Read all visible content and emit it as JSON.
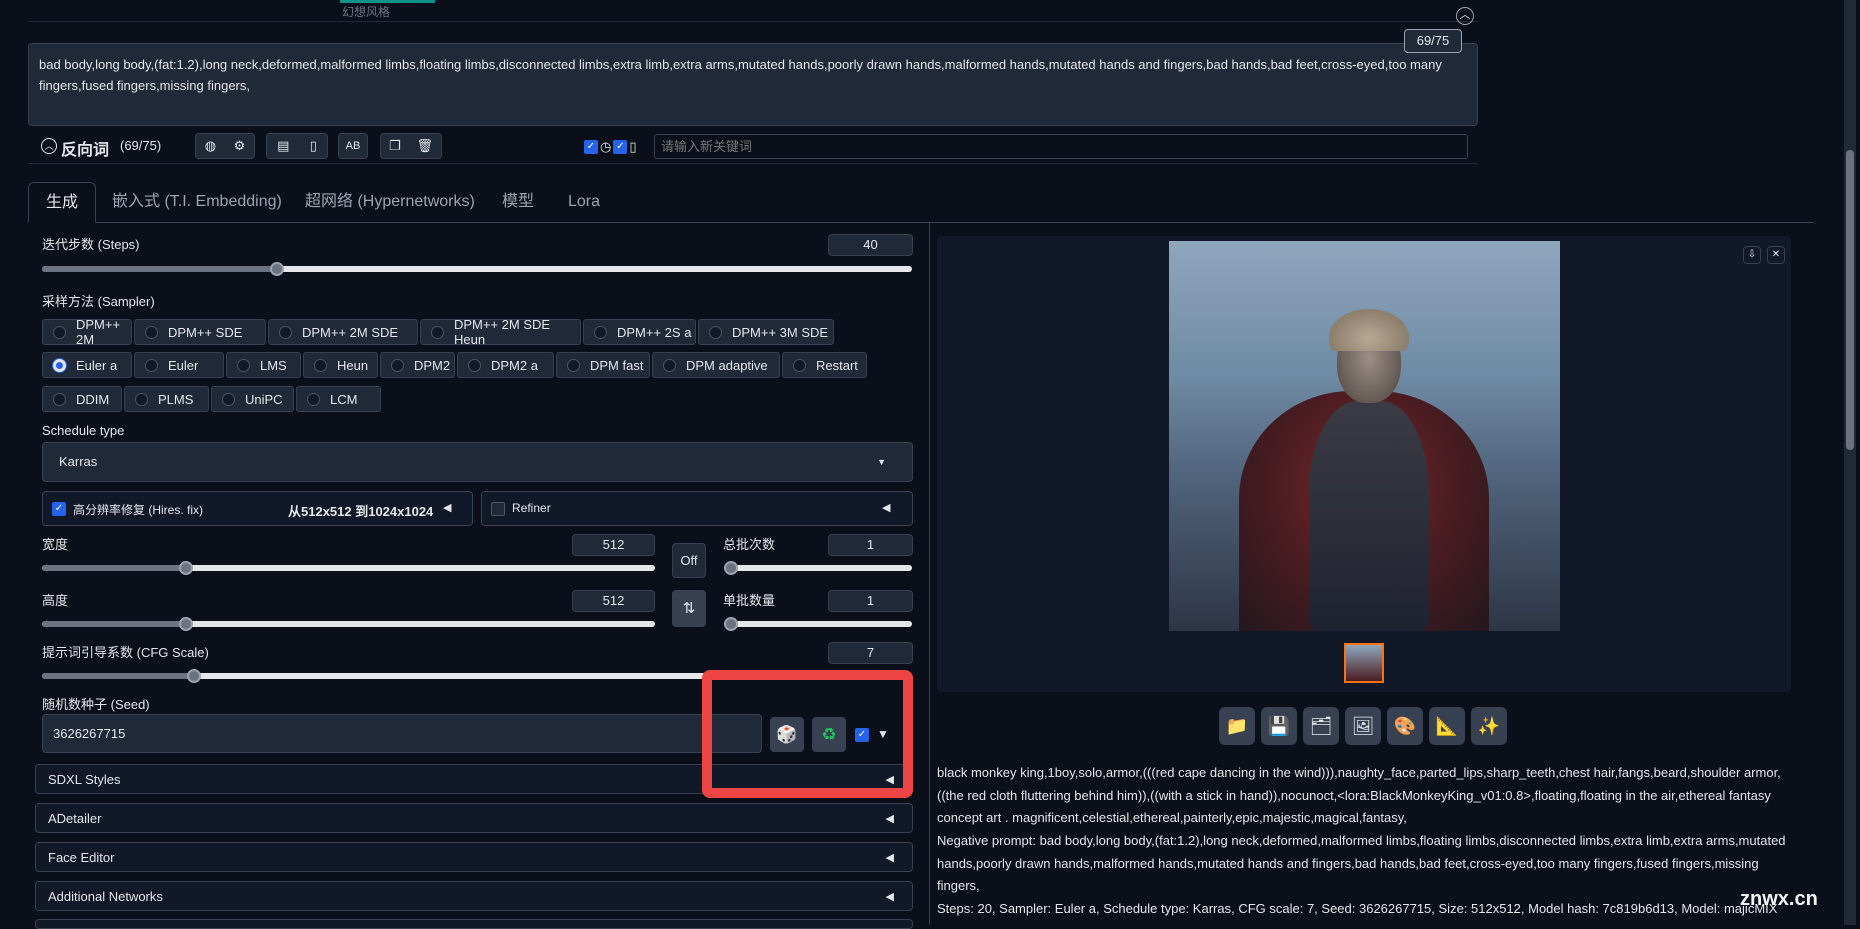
{
  "top": {
    "style_hint": "幻想风格"
  },
  "negative": {
    "text": "bad body,long body,(fat:1.2),long neck,deformed,malformed limbs,floating limbs,disconnected limbs,extra limb,extra arms,mutated hands,poorly drawn hands,malformed hands,mutated hands and fingers,bad hands,bad feet,cross-eyed,too many fingers,fused fingers,missing fingers,",
    "token_count": "69/75",
    "title": "反向词",
    "count": "(69/75)",
    "keyword_placeholder": "请输入新关键词"
  },
  "tabs": [
    "生成",
    "嵌入式 (T.I. Embedding)",
    "超网络 (Hypernetworks)",
    "模型",
    "Lora"
  ],
  "steps": {
    "label": "迭代步数 (Steps)",
    "value": "40",
    "fraction": 0.27
  },
  "sampler": {
    "label": "采样方法 (Sampler)",
    "options": [
      "DPM++ 2M",
      "DPM++ SDE",
      "DPM++ 2M SDE",
      "DPM++ 2M SDE Heun",
      "DPM++ 2S a",
      "DPM++ 3M SDE",
      "Euler a",
      "Euler",
      "LMS",
      "Heun",
      "DPM2",
      "DPM2 a",
      "DPM fast",
      "DPM adaptive",
      "Restart",
      "DDIM",
      "PLMS",
      "UniPC",
      "LCM"
    ],
    "selected": "Euler a"
  },
  "schedule": {
    "label": "Schedule type",
    "value": "Karras"
  },
  "hires": {
    "label": "高分辨率修复 (Hires. fix)",
    "size_text": "从512x512 到1024x1024"
  },
  "refiner": {
    "label": "Refiner"
  },
  "width": {
    "label": "宽度",
    "value": "512"
  },
  "height": {
    "label": "高度",
    "value": "512"
  },
  "off_label": "Off",
  "batch_count": {
    "label": "总批次数",
    "value": "1"
  },
  "batch_size": {
    "label": "单批数量",
    "value": "1"
  },
  "cfg": {
    "label": "提示词引导系数 (CFG Scale)",
    "value": "7"
  },
  "seed": {
    "label": "随机数种子 (Seed)",
    "value": "3626267715"
  },
  "accordions": [
    "SDXL Styles",
    "ADetailer",
    "Face Editor",
    "Additional Networks"
  ],
  "output_info": {
    "prompt": "black monkey king,1boy,solo,armor,(((red cape dancing in the wind))),naughty_face,parted_lips,sharp_teeth,chest hair,fangs,beard,shoulder armor,((the red cloth fluttering behind him)),((with a stick in hand)),nocunoct,<lora:BlackMonkeyKing_v01:0.8>,floating,floating in the air,ethereal fantasy concept art . magnificent,celestial,ethereal,painterly,epic,majestic,magical,fantasy,",
    "negative": "Negative prompt: bad body,long body,(fat:1.2),long neck,deformed,malformed limbs,floating limbs,disconnected limbs,extra limb,extra arms,mutated hands,poorly drawn hands,malformed hands,mutated hands and fingers,bad hands,bad feet,cross-eyed,too many fingers,fused fingers,missing fingers,",
    "params": "Steps: 20, Sampler: Euler a, Schedule type: Karras, CFG scale: 7, Seed: 3626267715, Size: 512x512, Model hash: 7c819b6d13, Model: majicMIX"
  },
  "watermark": "znwx.cn",
  "colors": {
    "accent": "#2563eb",
    "highlight_box": "#ef4444",
    "bg": "#0b0f19",
    "panel": "#111827"
  }
}
